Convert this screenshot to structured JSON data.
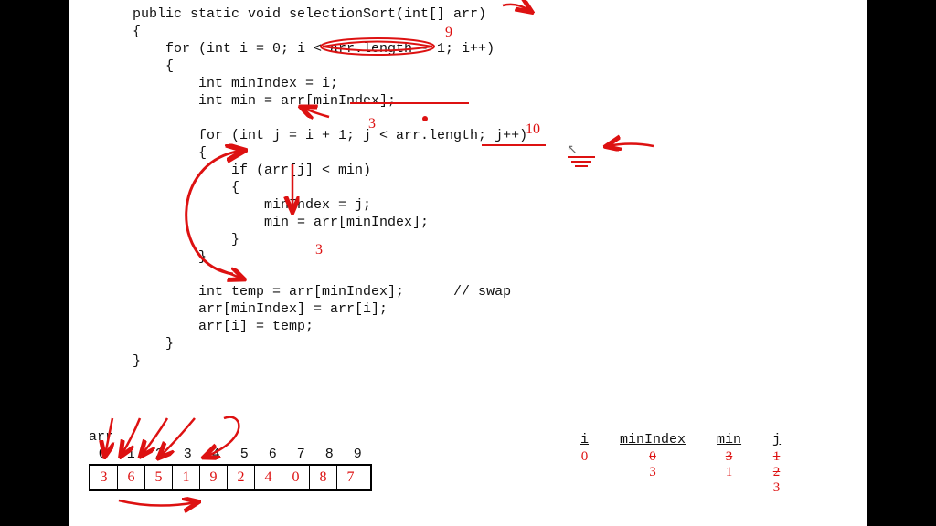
{
  "code": {
    "l1": "public static void selectionSort(int[] arr)",
    "l2": "{",
    "l3": "    for (int i = 0; i < arr.length - 1; i++)",
    "l4": "    {",
    "l5": "        int minIndex = i;",
    "l6": "        int min = arr[minIndex];",
    "l7": "",
    "l8": "        for (int j = i + 1; j < arr.length; j++)",
    "l9": "        {",
    "l10": "            if (arr[j] < min)",
    "l11": "            {",
    "l12": "                minIndex = j;",
    "l13": "                min = arr[minIndex];",
    "l14": "            }",
    "l15": "        }",
    "l16": "",
    "l17": "        int temp = arr[minIndex];      // swap",
    "l18": "        arr[minIndex] = arr[i];",
    "l19": "        arr[i] = temp;",
    "l20": "    }",
    "l21": "}"
  },
  "arr": {
    "label": "arr",
    "indices": [
      "0",
      "1",
      "2",
      "3",
      "4",
      "5",
      "6",
      "7",
      "8",
      "9"
    ],
    "values": [
      "3",
      "6",
      "5",
      "1",
      "9",
      "2",
      "4",
      "0",
      "8",
      "7"
    ]
  },
  "vars": {
    "i": {
      "name": "i",
      "vals": [
        "0"
      ]
    },
    "minIndex": {
      "name": "minIndex",
      "vals_strike": [
        "0"
      ],
      "vals": [
        "3"
      ]
    },
    "min": {
      "name": "min",
      "vals_strike": [
        "3"
      ],
      "vals": [
        "1"
      ]
    },
    "j": {
      "name": "j",
      "vals_strike": [
        "1",
        "2"
      ],
      "vals": [
        "3"
      ]
    }
  },
  "ann": {
    "n9": "9",
    "n3": "3",
    "n10": "10"
  }
}
